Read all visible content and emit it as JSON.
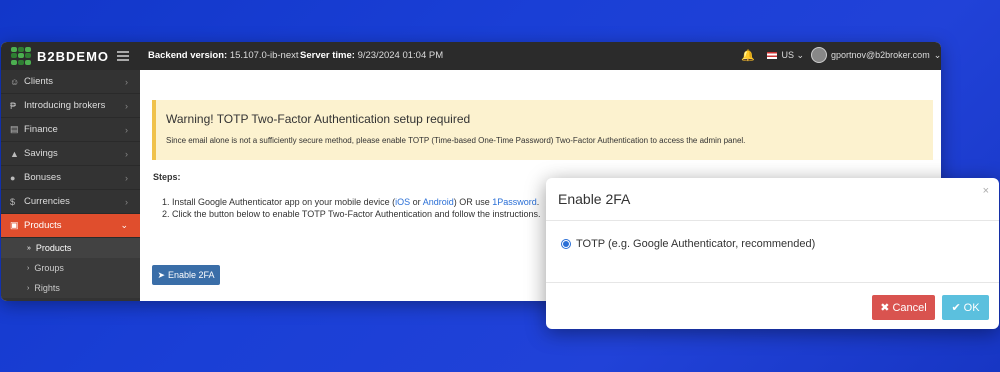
{
  "topbar": {
    "brand": "B2BDEMO",
    "backend_label": "Backend version:",
    "backend_value": "15.107.0-ib-next",
    "server_label": "Server time:",
    "server_value": "9/23/2024 01:04 PM",
    "language": "US",
    "user_email": "gportnov@b2broker.com"
  },
  "sidebar": {
    "items": [
      {
        "label": "Clients",
        "icon": "users-icon"
      },
      {
        "label": "Introducing brokers",
        "icon": "ib-icon"
      },
      {
        "label": "Finance",
        "icon": "money-icon"
      },
      {
        "label": "Savings",
        "icon": "savings-icon"
      },
      {
        "label": "Bonuses",
        "icon": "bonus-icon"
      },
      {
        "label": "Currencies",
        "icon": "dollar-icon"
      },
      {
        "label": "Products",
        "icon": "bag-icon"
      }
    ],
    "subitems": [
      "Products",
      "Groups",
      "Rights"
    ]
  },
  "warning": {
    "title": "Warning! TOTP Two-Factor Authentication setup required",
    "text": "Since email alone is not a sufficiently secure method, please enable TOTP (Time-based One-Time Password) Two-Factor Authentication to access the admin panel."
  },
  "steps": {
    "title": "Steps:",
    "step1_prefix": "1. Install Google Authenticator app on your mobile device (",
    "ios": "iOS",
    "or": "or",
    "android": "Android",
    "step1_mid": ") OR use",
    "onepassword": "1Password",
    "step1_suffix": ".",
    "step2": "2. Click the button below to enable TOTP Two-Factor Authentication and follow the instructions."
  },
  "enable_button": "Enable 2FA",
  "modal": {
    "title": "Enable 2FA",
    "close": "×",
    "option": "TOTP (e.g. Google Authenticator, recommended)",
    "cancel": "Cancel",
    "ok": "OK"
  },
  "colors": {
    "accent": "#e04e2d",
    "cancel": "#d9534f",
    "ok": "#5bc0de",
    "link": "#2a6fd6"
  }
}
